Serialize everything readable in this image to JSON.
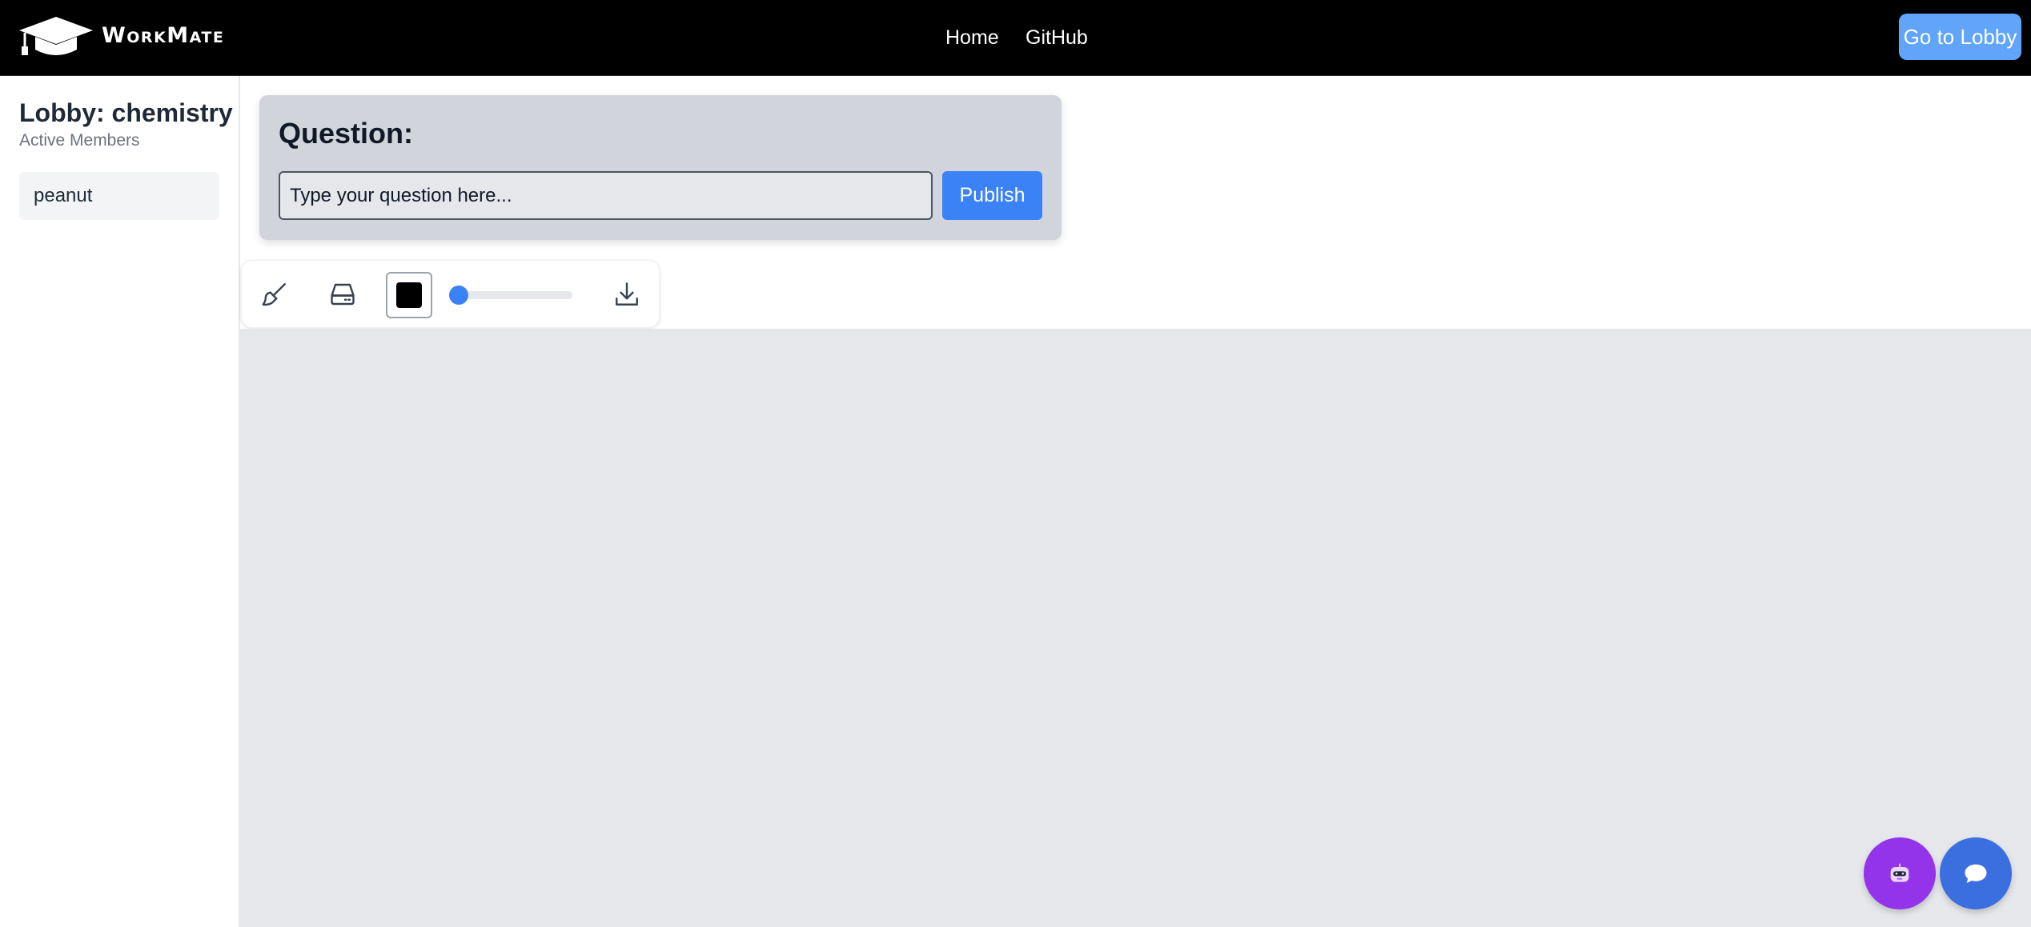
{
  "header": {
    "brand": "WorkMate",
    "nav": {
      "home": "Home",
      "github": "GitHub"
    },
    "lobby_button": "Go to Lobby"
  },
  "sidebar": {
    "lobby_title": "Lobby: chemistry",
    "members_label": "Active Members",
    "members": [
      "peanut"
    ]
  },
  "question": {
    "label": "Question:",
    "placeholder": "Type your question here...",
    "publish_label": "Publish"
  },
  "toolbar": {
    "icons": [
      "paintbrush-icon",
      "eraser-icon",
      "download-icon"
    ],
    "selected_color": "#000000",
    "brush_size_fraction": 0.05
  },
  "floating_buttons": {
    "icons": [
      "robot-icon",
      "chat-bubble-icon"
    ]
  },
  "colors": {
    "header_bg": "#000000",
    "accent": "#3b82f6",
    "lobby_button": "#60a5fa",
    "bot_button": "#9333ea",
    "canvas_bg": "#e5e7eb"
  }
}
